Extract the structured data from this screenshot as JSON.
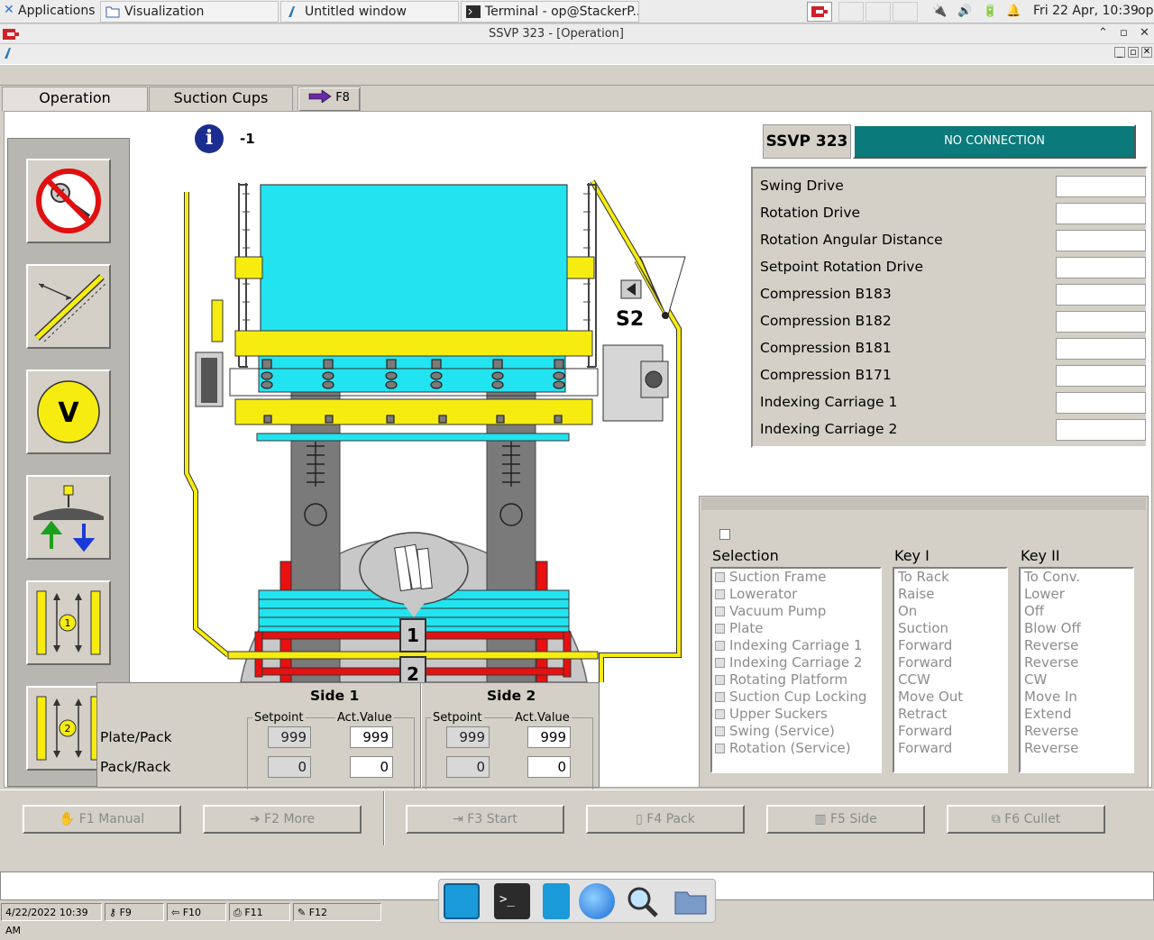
{
  "taskbar": {
    "apps_label": "Applications",
    "windows": [
      {
        "label": "Visualization"
      },
      {
        "label": "Untitled window"
      },
      {
        "label": "Terminal - op@StackerP..."
      }
    ],
    "clock": "Fri 22 Apr, 10:39",
    "user": "op"
  },
  "window": {
    "title": "SSVP 323 - [Operation]"
  },
  "tabs": [
    {
      "label": "Operation"
    },
    {
      "label": "Suction Cups"
    },
    {
      "label": "F8"
    }
  ],
  "info": {
    "value": "-1"
  },
  "machine": {
    "s2_label": "S2",
    "marker_1": "1",
    "marker_2": "2"
  },
  "status": {
    "device": "SSVP 323",
    "connection": "NO CONNECTION",
    "color": "#0a7a7a"
  },
  "params": [
    {
      "label": "Swing Drive",
      "value": ""
    },
    {
      "label": "Rotation Drive",
      "value": ""
    },
    {
      "label": "Rotation Angular Distance",
      "value": ""
    },
    {
      "label": "Setpoint Rotation Drive",
      "value": ""
    },
    {
      "label": "Compression B183",
      "value": ""
    },
    {
      "label": "Compression B182",
      "value": ""
    },
    {
      "label": "Compression B181",
      "value": ""
    },
    {
      "label": "Compression B171",
      "value": ""
    },
    {
      "label": "Indexing Carriage 1",
      "value": ""
    },
    {
      "label": "Indexing Carriage 2",
      "value": ""
    }
  ],
  "keys": {
    "selection_title": "Selection",
    "key1_title": "Key I",
    "key2_title": "Key II",
    "selection": [
      "Suction Frame",
      "Lowerator",
      "Vacuum Pump",
      "Plate",
      "Indexing Carriage 1",
      "Indexing Carriage 2",
      "Rotating Platform",
      "Suction Cup Locking",
      "Upper Suckers",
      "Swing (Service)",
      "Rotation (Service)"
    ],
    "key1": [
      "To Rack",
      "Raise",
      "On",
      "Suction",
      "Forward",
      "Forward",
      "CCW",
      "Move Out",
      "Retract",
      "Forward",
      "Forward"
    ],
    "key2": [
      "To Conv.",
      "Lower",
      "Off",
      "Blow Off",
      "Reverse",
      "Reverse",
      "CW",
      "Move In",
      "Extend",
      "Reverse",
      "Reverse"
    ]
  },
  "sides": {
    "side1_title": "Side 1",
    "side2_title": "Side 2",
    "setpoint_label": "Setpoint",
    "actvalue_label": "Act.Value",
    "row1_label": "Plate/Pack",
    "row2_label": "Pack/Rack",
    "side1": {
      "plate_setpoint": "999",
      "plate_act": "999",
      "pack_setpoint": "0",
      "pack_act": "0"
    },
    "side2": {
      "plate_setpoint": "999",
      "plate_act": "999",
      "pack_setpoint": "0",
      "pack_act": "0"
    }
  },
  "fkeys": [
    {
      "label": "F1 Manual"
    },
    {
      "label": "F2 More"
    },
    {
      "label": "F3 Start"
    },
    {
      "label": "F4 Pack"
    },
    {
      "label": "F5 Side"
    },
    {
      "label": "F6 Cullet"
    }
  ],
  "statusbar": {
    "datetime": "4/22/2022 10:39 AM",
    "k9": "F9",
    "k10": "F10",
    "k11": "F11",
    "k12": "F12"
  },
  "icons": [
    "no-tools-icon",
    "angle-measure-icon",
    "v-icon",
    "lift-icon",
    "carriage-1-icon",
    "carriage-2-icon"
  ]
}
